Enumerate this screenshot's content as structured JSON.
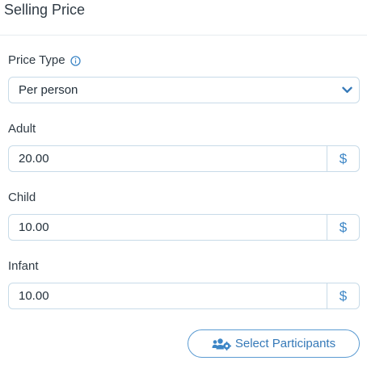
{
  "header": {
    "title": "Selling Price"
  },
  "price_type": {
    "label": "Price Type",
    "info_icon": "info-circle-icon",
    "selected": "Per person",
    "chevron_icon": "chevron-down-icon"
  },
  "fields": [
    {
      "label": "Adult",
      "value": "20.00",
      "currency": "$"
    },
    {
      "label": "Child",
      "value": "10.00",
      "currency": "$"
    },
    {
      "label": "Infant",
      "value": "10.00",
      "currency": "$"
    }
  ],
  "actions": {
    "select_participants_label": "Select Participants",
    "select_participants_icon": "users-cog-icon"
  },
  "colors": {
    "accent": "#3d86c6",
    "border": "#c8dbe8",
    "text": "#2f3a44"
  }
}
